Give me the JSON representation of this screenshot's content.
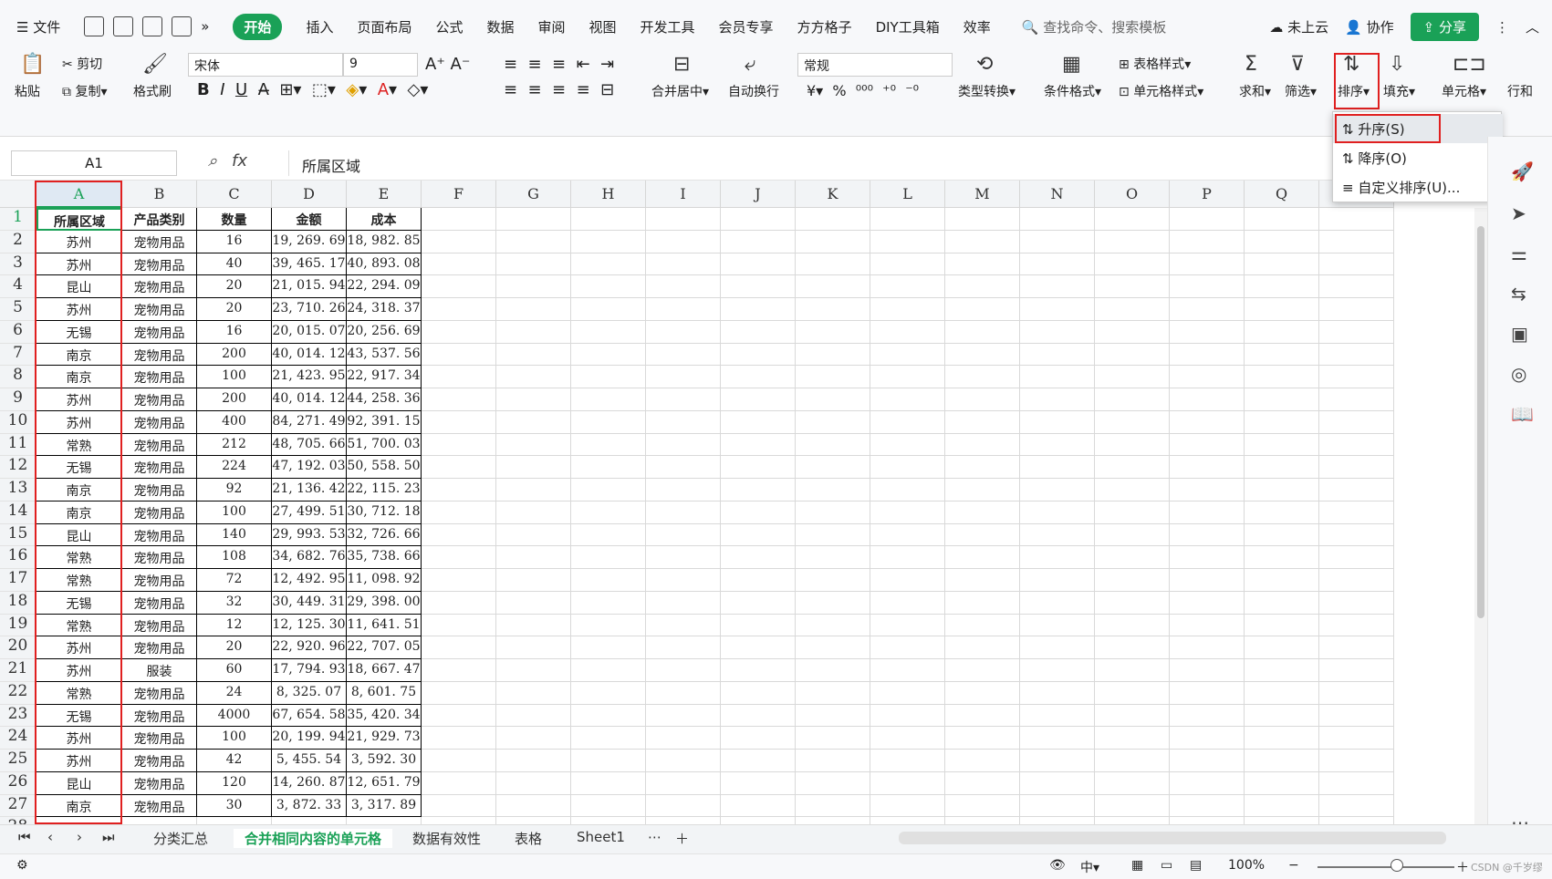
{
  "menubar": {
    "file": "文件",
    "tabs": [
      "开始",
      "插入",
      "页面布局",
      "公式",
      "数据",
      "审阅",
      "视图",
      "开发工具",
      "会员专享",
      "方方格子",
      "DIY工具箱",
      "效率"
    ],
    "active_tab": "开始",
    "search": "查找命令、搜索模板",
    "cloud": "未上云",
    "collab": "协作",
    "share": "分享"
  },
  "ribbon": {
    "paste": "粘贴",
    "cut": "剪切",
    "copy": "复制",
    "format_painter": "格式刷",
    "font_name": "宋体",
    "font_size": "9",
    "merge": "合并居中",
    "wrap": "自动换行",
    "number_format": "常规",
    "type_convert": "类型转换",
    "cond_format": "条件格式",
    "table_style": "表格样式",
    "cell_style": "单元格样式",
    "sum": "求和",
    "filter": "筛选",
    "sort": "排序",
    "fill": "填充",
    "cell": "单元格",
    "rowcol": "行和"
  },
  "sort_menu": {
    "asc": "升序(S)",
    "desc": "降序(O)",
    "custom": "自定义排序(U)..."
  },
  "formula": {
    "name_box": "A1",
    "value": "所属区域"
  },
  "columns": [
    "A",
    "B",
    "C",
    "D",
    "E",
    "F",
    "G",
    "H",
    "I",
    "J",
    "K",
    "L",
    "M",
    "N",
    "O",
    "P",
    "Q",
    "R"
  ],
  "rows": [
    "1",
    "2",
    "3",
    "4",
    "5",
    "6",
    "7",
    "8",
    "9",
    "10",
    "11",
    "12",
    "13",
    "14",
    "15",
    "16",
    "17",
    "18",
    "19",
    "20",
    "21",
    "22",
    "23",
    "24",
    "25",
    "26",
    "27",
    "28"
  ],
  "table_header": [
    "所属区域",
    "产品类别",
    "数量",
    "金额",
    "成本"
  ],
  "table_rows": [
    [
      "苏州",
      "宠物用品",
      "16",
      "19, 269. 69",
      "18, 982. 85"
    ],
    [
      "苏州",
      "宠物用品",
      "40",
      "39, 465. 17",
      "40, 893. 08"
    ],
    [
      "昆山",
      "宠物用品",
      "20",
      "21, 015. 94",
      "22, 294. 09"
    ],
    [
      "苏州",
      "宠物用品",
      "20",
      "23, 710. 26",
      "24, 318. 37"
    ],
    [
      "无锡",
      "宠物用品",
      "16",
      "20, 015. 07",
      "20, 256. 69"
    ],
    [
      "南京",
      "宠物用品",
      "200",
      "40, 014. 12",
      "43, 537. 56"
    ],
    [
      "南京",
      "宠物用品",
      "100",
      "21, 423. 95",
      "22, 917. 34"
    ],
    [
      "苏州",
      "宠物用品",
      "200",
      "40, 014. 12",
      "44, 258. 36"
    ],
    [
      "苏州",
      "宠物用品",
      "400",
      "84, 271. 49",
      "92, 391. 15"
    ],
    [
      "常熟",
      "宠物用品",
      "212",
      "48, 705. 66",
      "51, 700. 03"
    ],
    [
      "无锡",
      "宠物用品",
      "224",
      "47, 192. 03",
      "50, 558. 50"
    ],
    [
      "南京",
      "宠物用品",
      "92",
      "21, 136. 42",
      "22, 115. 23"
    ],
    [
      "南京",
      "宠物用品",
      "100",
      "27, 499. 51",
      "30, 712. 18"
    ],
    [
      "昆山",
      "宠物用品",
      "140",
      "29, 993. 53",
      "32, 726. 66"
    ],
    [
      "常熟",
      "宠物用品",
      "108",
      "34, 682. 76",
      "35, 738. 66"
    ],
    [
      "常熟",
      "宠物用品",
      "72",
      "12, 492. 95",
      "11, 098. 92"
    ],
    [
      "无锡",
      "宠物用品",
      "32",
      "30, 449. 31",
      "29, 398. 00"
    ],
    [
      "常熟",
      "宠物用品",
      "12",
      "12, 125. 30",
      "11, 641. 51"
    ],
    [
      "苏州",
      "宠物用品",
      "20",
      "22, 920. 96",
      "22, 707. 05"
    ],
    [
      "苏州",
      "服装",
      "60",
      "17, 794. 93",
      "18, 667. 47"
    ],
    [
      "常熟",
      "宠物用品",
      "24",
      "8, 325. 07",
      "8, 601. 75"
    ],
    [
      "无锡",
      "宠物用品",
      "4000",
      "67, 654. 58",
      "35, 420. 34"
    ],
    [
      "苏州",
      "宠物用品",
      "100",
      "20, 199. 94",
      "21, 929. 73"
    ],
    [
      "苏州",
      "宠物用品",
      "42",
      "5, 455. 54",
      "3, 592. 30"
    ],
    [
      "昆山",
      "宠物用品",
      "120",
      "14, 260. 87",
      "12, 651. 79"
    ],
    [
      "南京",
      "宠物用品",
      "30",
      "3, 872. 33",
      "3, 317. 89"
    ]
  ],
  "sheets": [
    "分类汇总",
    "合并相同内容的单元格",
    "数据有效性",
    "表格",
    "Sheet1"
  ],
  "active_sheet": "合并相同内容的单元格",
  "status": {
    "zoom": "100%",
    "watermark": "CSDN @千岁缪"
  },
  "accent_color": "#1aa157",
  "highlight_color": "#e02020"
}
